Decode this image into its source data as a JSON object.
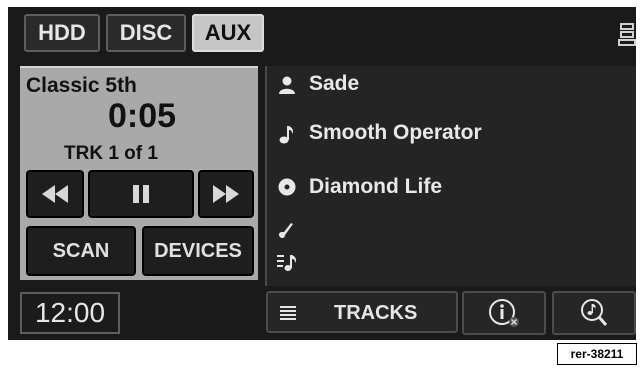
{
  "source_tabs": [
    {
      "label": "HDD",
      "active": false
    },
    {
      "label": "DISC",
      "active": false
    },
    {
      "label": "AUX",
      "active": true
    }
  ],
  "now_playing": {
    "title": "Classic 5th",
    "time": "0:05",
    "track": "TRK 1 of 1"
  },
  "controls": {
    "scan_label": "SCAN",
    "devices_label": "DEVICES"
  },
  "metadata": {
    "artist": "Sade",
    "song": "Smooth Operator",
    "album": "Diamond Life",
    "genre": "",
    "composer": ""
  },
  "bottom": {
    "clock": "12:00",
    "tracks_label": "TRACKS"
  },
  "reference_code": "rer-38211",
  "colors": {
    "active_tab": "#c6c6c6",
    "panel_gray": "#a9a9a9",
    "screen_bg": "#1a1a1a"
  }
}
